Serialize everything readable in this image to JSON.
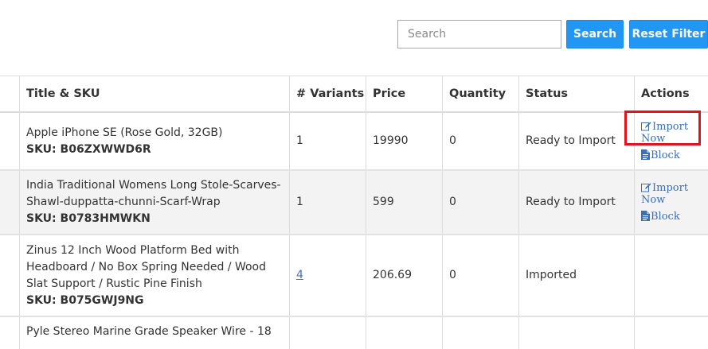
{
  "toolbar": {
    "search_placeholder": "Search",
    "search_label": "Search",
    "reset_label": "Reset Filter"
  },
  "table": {
    "headers": {
      "title_sku": "Title & SKU",
      "variants": "# Variants",
      "price": "Price",
      "quantity": "Quantity",
      "status": "Status",
      "actions": "Actions"
    },
    "rows": [
      {
        "title": "Apple iPhone SE (Rose Gold, 32GB)",
        "sku": "SKU: B06ZXWWD6R",
        "variants": "1",
        "price": "19990",
        "quantity": "0",
        "status": "Ready to Import",
        "import_label": "Import Now",
        "block_label": "Block"
      },
      {
        "title_line1": "India Traditional Womens Long Stole-Scarves-",
        "title_line2": "Shawl-duppatta-chunni-Scarf-Wrap",
        "sku": "SKU: B0783HMWKN",
        "variants": "1",
        "price": "599",
        "quantity": "0",
        "status": "Ready to Import",
        "import_label": "Import Now",
        "block_label": "Block"
      },
      {
        "title_line1": "Zinus 12 Inch Wood Platform Bed with",
        "title_line2": "Headboard / No Box Spring Needed / Wood",
        "title_line3": "Slat Support / Rustic Pine Finish",
        "sku": "SKU: B075GWJ9NG",
        "variants": "4",
        "price": "206.69",
        "quantity": "0",
        "status": "Imported"
      },
      {
        "title_line1": "Pyle Stereo Marine Grade Speaker Wire - 18"
      }
    ]
  },
  "colors": {
    "button_blue": "#2196f3",
    "link_blue": "#3b6fb6",
    "highlight_red": "#e0141e",
    "alt_row": "#f3f3f3"
  },
  "icons": {
    "import": "edit-icon",
    "block": "document-icon"
  }
}
